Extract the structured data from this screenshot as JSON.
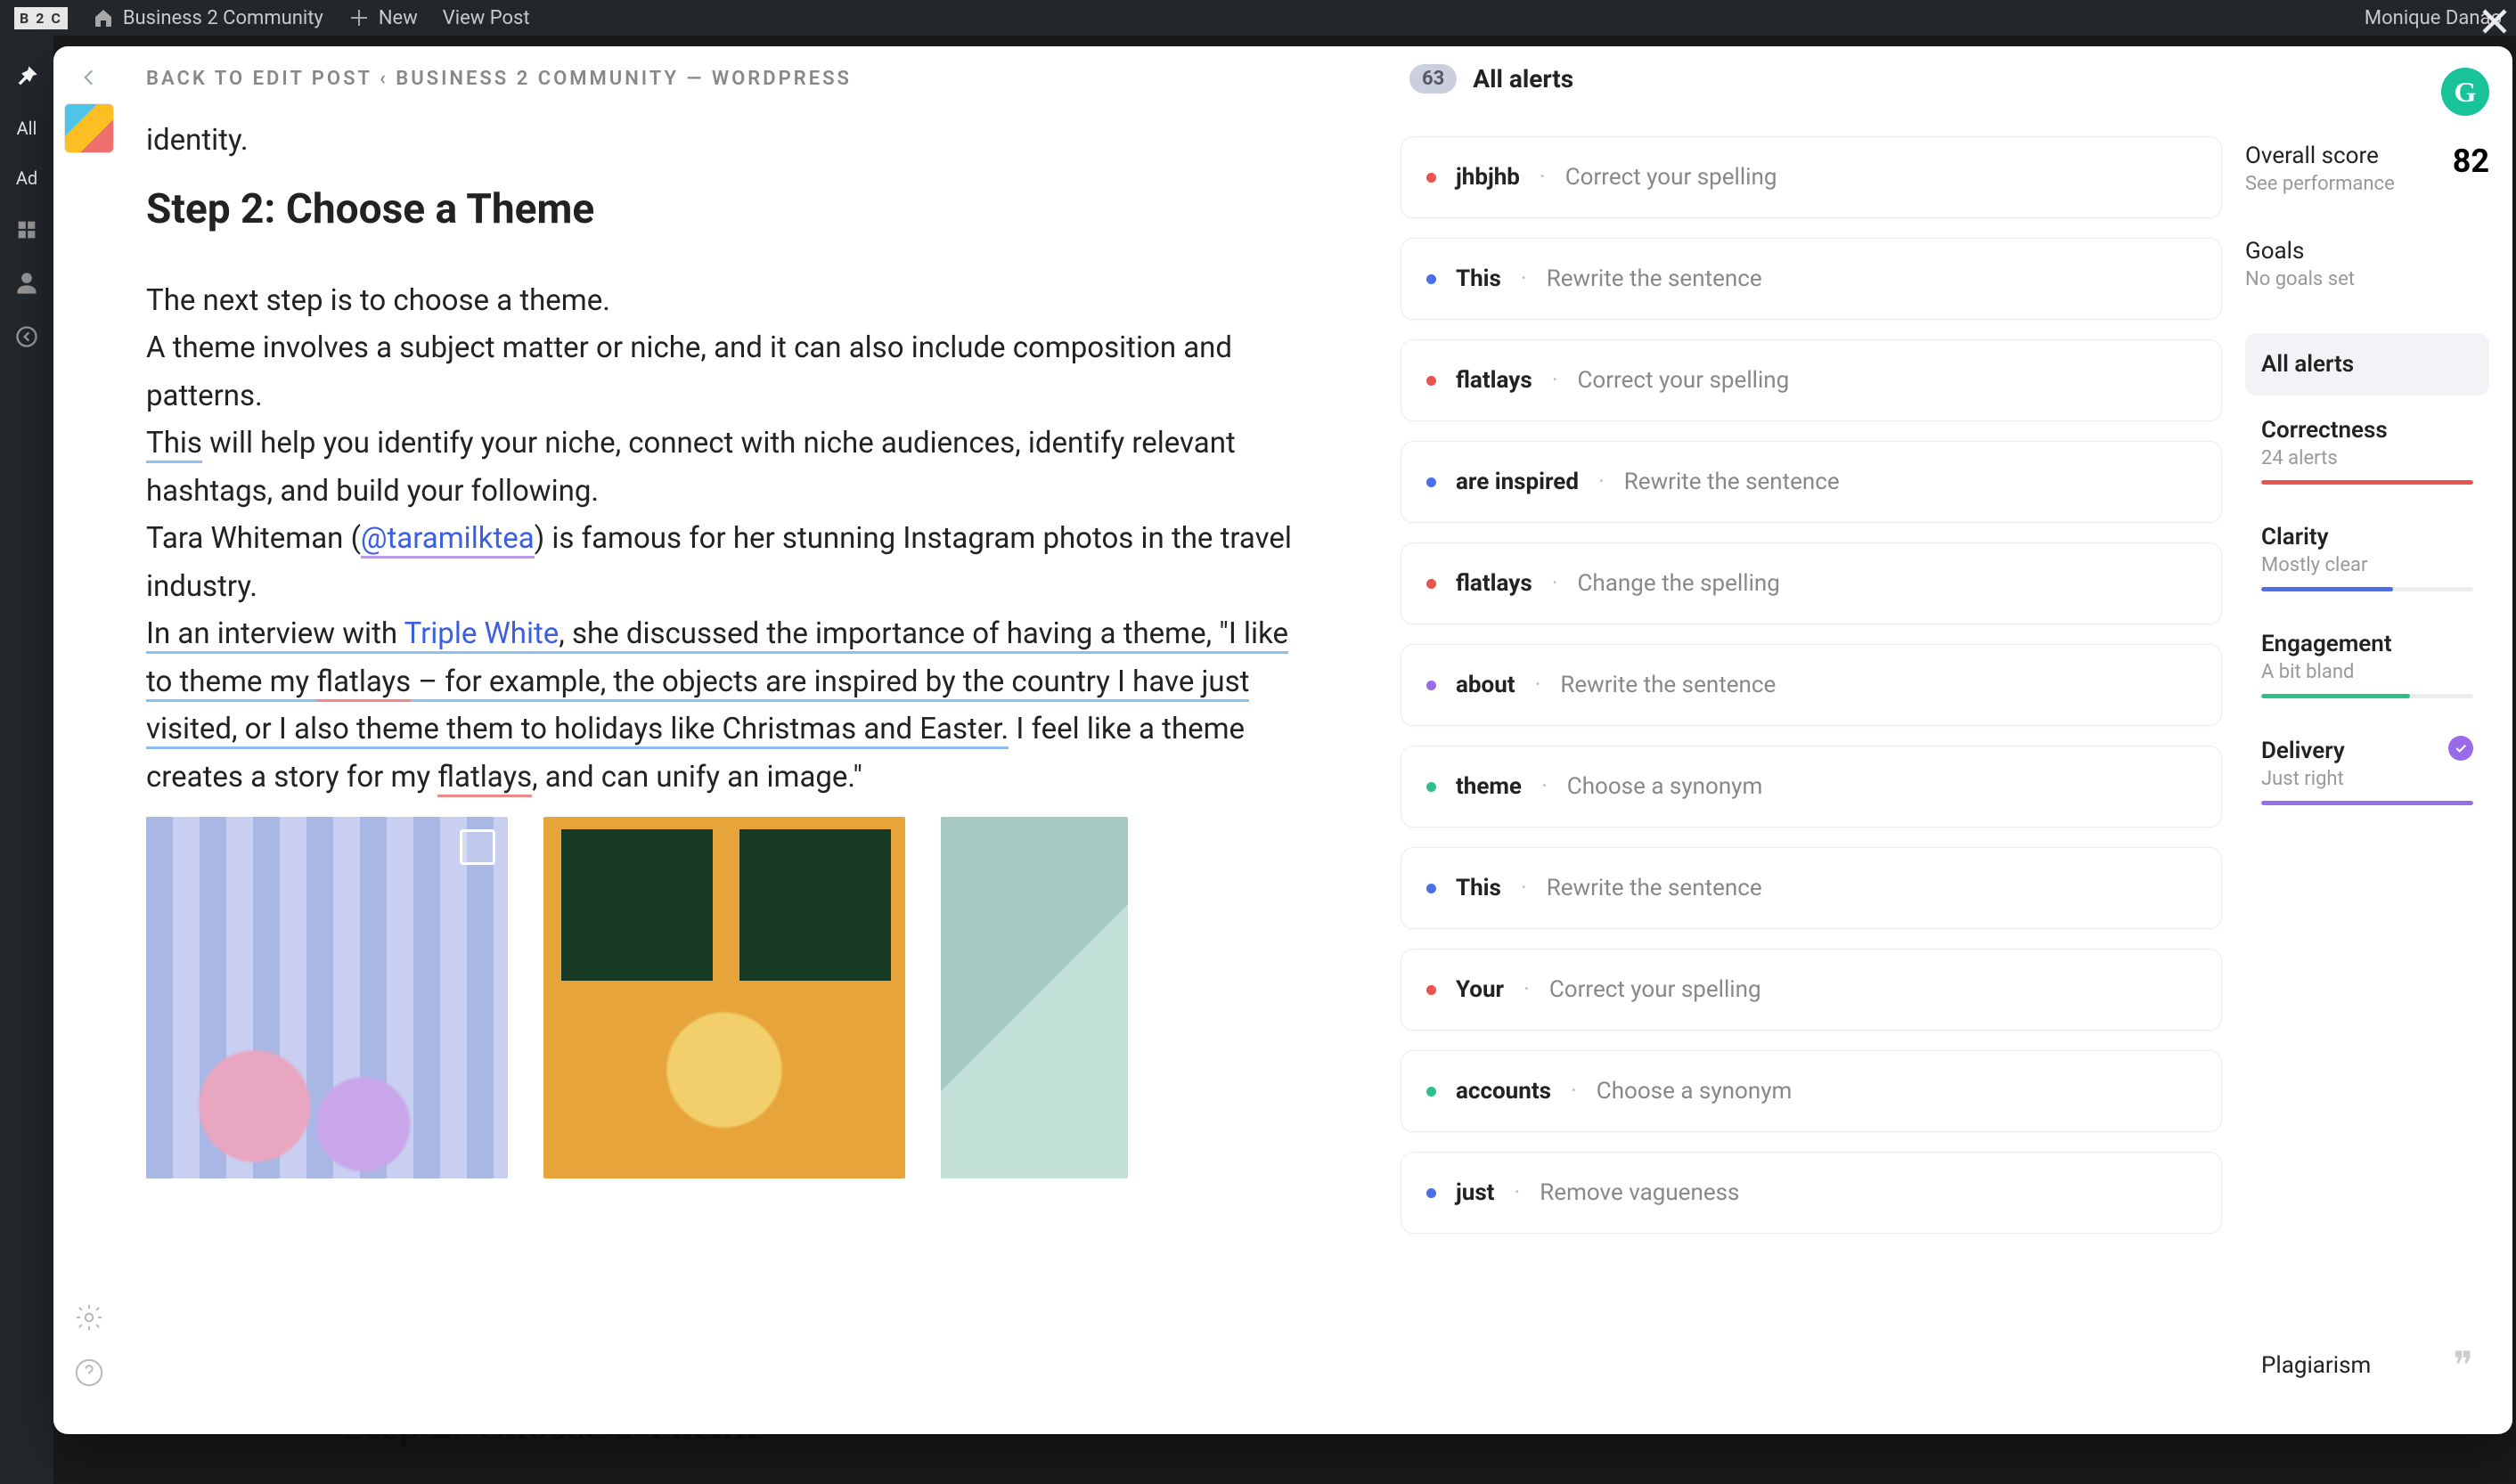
{
  "wp_bar": {
    "logo": "B 2 C",
    "site": "Business 2 Community",
    "new": "New",
    "view_post": "View Post",
    "user": "Monique Danao"
  },
  "wp_side": {
    "all": "All",
    "add": "Ad"
  },
  "breadcrumb": "BACK TO EDIT POST ‹ BUSINESS 2 COMMUNITY — WORDPRESS",
  "doc": {
    "tail": "identity.",
    "h2": "Step 2: Choose a Theme",
    "p1": "The next step is to choose a theme.",
    "p2": "A theme involves a subject matter or niche, and it can also include composition and patterns.",
    "p3a": "This",
    "p3b": " will help you identify your niche, connect with niche audiences, identify relevant hashtags, and build your following.",
    "p4a": "Tara Whiteman (",
    "p4b": "@taramilktea",
    "p4c": ") is famous for her stunning Instagram photos in the travel industry.",
    "p5a": "In an interview with ",
    "p5b": "Triple White",
    "p5c": ", she discussed the importance of ",
    "p5d": "having a theme, \"I like to theme my ",
    "p5e": "flatlays",
    "p5f": " – for example, the ",
    "p5g": "objects ",
    "p5h": "are inspired",
    "p5i": " by the country I have just visited, or I also ",
    "p5j": "theme them to holidays like Christmas and Easter.",
    "p5k": " I feel like a theme creates a story for my ",
    "p5l": "flatlays",
    "p5m": ", and can unify an image.\""
  },
  "alerts": {
    "count": "63",
    "title": "All alerts",
    "items": [
      {
        "dot": "d-red",
        "term": "jhbjhb",
        "sugg": "Correct your spelling"
      },
      {
        "dot": "d-blue",
        "term": "This",
        "sugg": "Rewrite the sentence"
      },
      {
        "dot": "d-red",
        "term": "flatlays",
        "sugg": "Correct your spelling"
      },
      {
        "dot": "d-blue",
        "term": "are inspired",
        "sugg": "Rewrite the sentence"
      },
      {
        "dot": "d-red",
        "term": "flatlays",
        "sugg": "Change the spelling"
      },
      {
        "dot": "d-purple",
        "term": "about",
        "sugg": "Rewrite the sentence"
      },
      {
        "dot": "d-green",
        "term": "theme",
        "sugg": "Choose a synonym"
      },
      {
        "dot": "d-blue",
        "term": "This",
        "sugg": "Rewrite the sentence"
      },
      {
        "dot": "d-red",
        "term": "Your",
        "sugg": "Correct your spelling"
      },
      {
        "dot": "d-green",
        "term": "accounts",
        "sugg": "Choose a synonym"
      },
      {
        "dot": "d-blue",
        "term": "just",
        "sugg": "Remove vagueness"
      }
    ]
  },
  "score": {
    "label": "Overall score",
    "value": "82",
    "sub": "See performance",
    "goals_t": "Goals",
    "goals_s": "No goals set",
    "all_alerts": "All alerts",
    "cats": {
      "correctness_t": "Correctness",
      "correctness_s": "24 alerts",
      "clarity_t": "Clarity",
      "clarity_s": "Mostly clear",
      "engagement_t": "Engagement",
      "engagement_s": "A bit bland",
      "delivery_t": "Delivery",
      "delivery_s": "Just right"
    },
    "plag": "Plagiarism"
  },
  "underlay_h": "Step 2: Choose a Theme"
}
